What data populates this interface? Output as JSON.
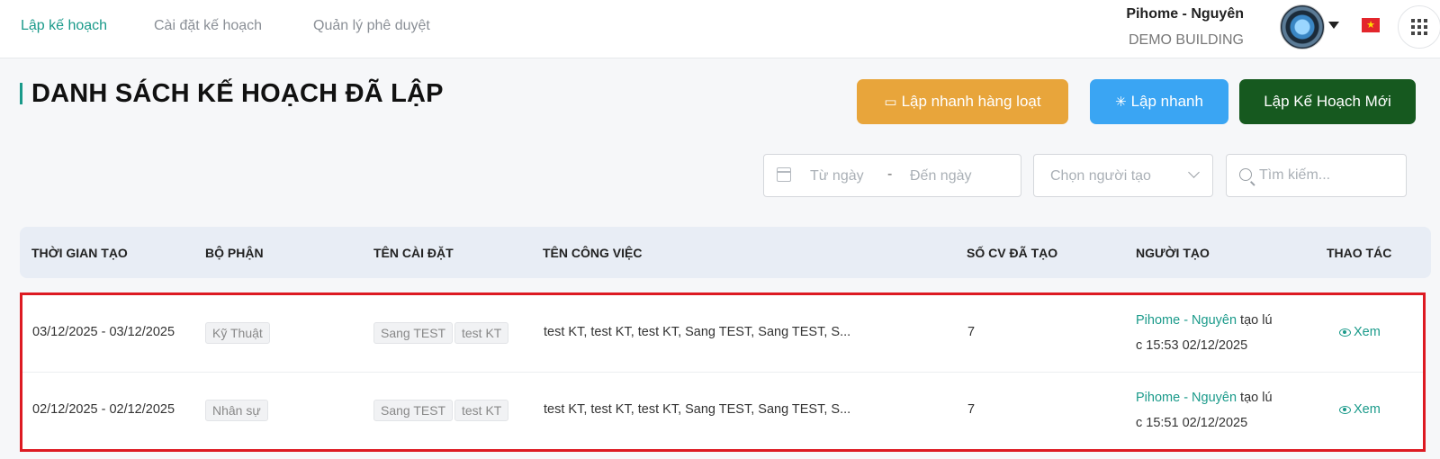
{
  "nav": {
    "items": [
      {
        "label": "Lập kế hoạch",
        "active": true
      },
      {
        "label": "Cài đặt kế hoạch",
        "active": false
      },
      {
        "label": "Quản lý phê duyệt",
        "active": false
      }
    ]
  },
  "user": {
    "name": "Pihome - Nguyên",
    "building": "DEMO BUILDING",
    "flag_icon": "vietnam-flag-icon",
    "flag_star": "★"
  },
  "page": {
    "title": "DANH SÁCH KẾ HOẠCH ĐÃ LẬP"
  },
  "actions": {
    "bulk_label": "Lập nhanh hàng loạt",
    "bulk_icon": "▭",
    "quick_label": "Lập nhanh",
    "quick_icon": "✳",
    "new_label": "Lập Kế Hoạch Mới"
  },
  "filters": {
    "date_from_placeholder": "Từ ngày",
    "date_separator": "-",
    "date_to_placeholder": "Đến ngày",
    "creator_placeholder": "Chọn người tạo",
    "search_placeholder": "Tìm kiếm..."
  },
  "table": {
    "headers": {
      "created_time": "THỜI GIAN TẠO",
      "department": "BỘ PHẬN",
      "setting_name": "TÊN CÀI ĐẶT",
      "task_name": "TÊN CÔNG VIỆC",
      "task_count": "SỐ CV ĐÃ TẠO",
      "creator": "NGƯỜI TẠO",
      "actions": "THAO TÁC"
    },
    "rows": [
      {
        "created_time": "03/12/2025 - 03/12/2025",
        "department": "Kỹ Thuật",
        "settings": [
          "Sang TEST",
          "test KT"
        ],
        "task_name": "test KT, test KT, test KT, Sang TEST, Sang TEST, S...",
        "task_count": "7",
        "creator_name": "Pihome - Nguyên",
        "creator_line1_rest": " tạo lú",
        "creator_line2": "c 15:53 02/12/2025",
        "action_label": "Xem"
      },
      {
        "created_time": "02/12/2025 - 02/12/2025",
        "department": "Nhân sự",
        "settings": [
          "Sang TEST",
          "test KT"
        ],
        "task_name": "test KT, test KT, test KT, Sang TEST, Sang TEST, S...",
        "task_count": "7",
        "creator_name": "Pihome - Nguyên",
        "creator_line1_rest": " tạo lú",
        "creator_line2": "c 15:51 02/12/2025",
        "action_label": "Xem"
      }
    ]
  },
  "colors": {
    "accent": "#1a9a8a",
    "bulk_button": "#e8a53b",
    "quick_button": "#3aa5f3",
    "new_button": "#16591f",
    "highlight_border": "#dd1a22"
  }
}
